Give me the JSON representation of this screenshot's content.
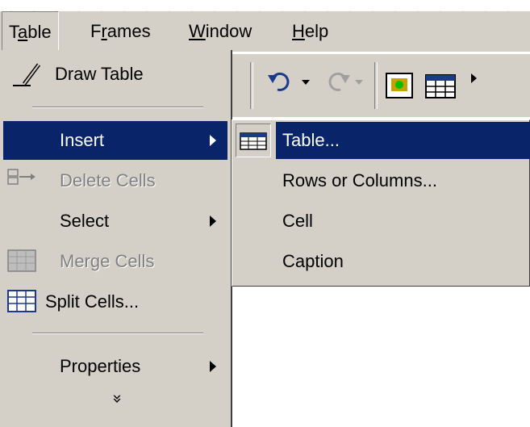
{
  "menubar": {
    "items": [
      {
        "label": "Table"
      },
      {
        "label": "Frames"
      },
      {
        "label": "Window"
      },
      {
        "label": "Help"
      }
    ]
  },
  "table_menu": {
    "draw_table": "Draw Table",
    "insert": "Insert",
    "delete_cells": "Delete Cells",
    "select": "Select",
    "merge_cells": "Merge Cells",
    "split_cells": "Split Cells...",
    "properties": "Properties",
    "expand_glyph": "»"
  },
  "insert_submenu": {
    "table": "Table...",
    "rows_or_columns": "Rows or Columns...",
    "cell": "Cell",
    "caption": "Caption"
  },
  "colors": {
    "menu_bg": "#d4d0c8",
    "highlight": "#0a246a",
    "disabled_text": "#808080"
  }
}
